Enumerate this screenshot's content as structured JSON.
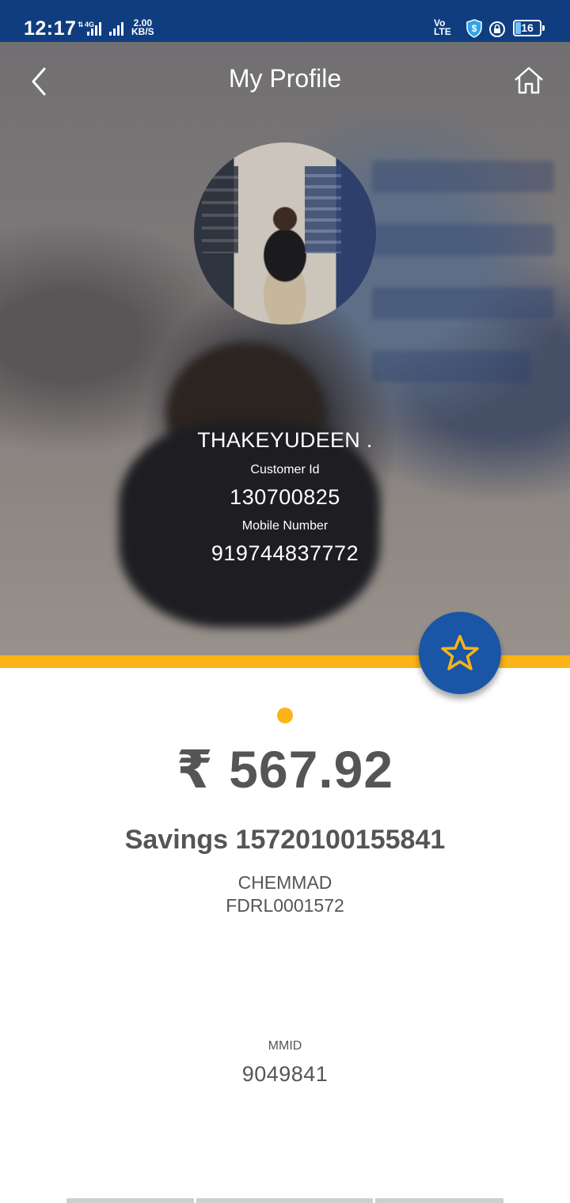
{
  "status_bar": {
    "time": "12:17",
    "network_type": "4G",
    "speed_value": "2.00",
    "speed_unit": "KB/S",
    "volte_label_top": "Vo",
    "volte_label_bottom": "LTE",
    "battery_level": "16"
  },
  "header": {
    "title": "My Profile",
    "back_icon": "chevron-left-icon",
    "home_icon": "home-icon"
  },
  "profile": {
    "name": "THAKEYUDEEN .",
    "customer_id_label": "Customer Id",
    "customer_id": "130700825",
    "mobile_label": "Mobile Number",
    "mobile_number": "919744837772"
  },
  "favorite_button": {
    "icon": "star-icon"
  },
  "account": {
    "balance": "₹ 567.92",
    "account_line": "Savings 15720100155841",
    "branch": "CHEMMAD",
    "ifsc": "FDRL0001572",
    "mmid_label": "MMID",
    "mmid": "9049841"
  },
  "colors": {
    "status_bar": "#0f3d80",
    "accent_yellow": "#fbb317",
    "fab_blue": "#1a56a5",
    "text_gray": "#555555"
  }
}
